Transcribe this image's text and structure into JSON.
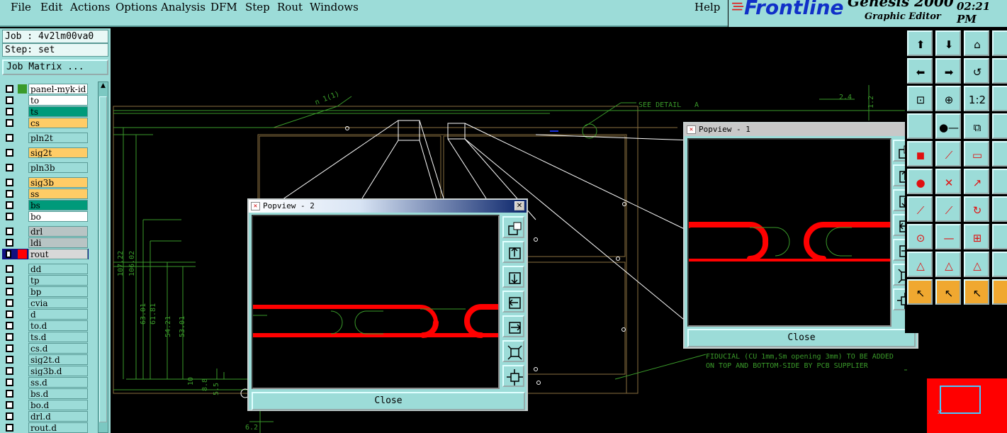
{
  "menu": {
    "items": [
      "File",
      "Edit",
      "Actions",
      "Options",
      "Analysis",
      "DFM",
      "Step",
      "Rout",
      "Windows"
    ],
    "help": "Help"
  },
  "brand": {
    "logo": "Frontline",
    "app": "Genesis 2000",
    "subtitle": "Graphic Editor",
    "clock": "02:21 PM"
  },
  "job": {
    "job_line": "Job : 4v2lm00va0",
    "step_line": "Step: set",
    "matrix_button": "Job Matrix ..."
  },
  "layers": [
    {
      "name": "panel-myk-id",
      "color": "#ffffff",
      "swatch": "#3a9a2a",
      "checked": false
    },
    {
      "name": "to",
      "color": "#ffffff",
      "swatch": "",
      "checked": false
    },
    {
      "name": "ts",
      "color": "#009a7a",
      "swatch": "",
      "checked": false
    },
    {
      "name": "cs",
      "color": "#ffcc66",
      "swatch": "",
      "checked": false
    },
    {
      "name": "pln2t",
      "color": "#9cdcd8",
      "swatch": "",
      "checked": false
    },
    {
      "name": "sig2t",
      "color": "#ffcc66",
      "swatch": "",
      "checked": false
    },
    {
      "name": "pln3b",
      "color": "#9cdcd8",
      "swatch": "",
      "checked": false
    },
    {
      "name": "sig3b",
      "color": "#ffcc66",
      "swatch": "",
      "checked": false
    },
    {
      "name": "ss",
      "color": "#ffcc66",
      "swatch": "",
      "checked": false
    },
    {
      "name": "bs",
      "color": "#009a7a",
      "swatch": "",
      "checked": false
    },
    {
      "name": "bo",
      "color": "#ffffff",
      "swatch": "",
      "checked": false
    },
    {
      "name": "drl",
      "color": "#b8c4c4",
      "swatch": "",
      "checked": false
    },
    {
      "name": "ldi",
      "color": "#b8c4c4",
      "swatch": "",
      "checked": false
    },
    {
      "name": "rout",
      "color": "#d8d8d8",
      "swatch": "#ff0000",
      "checked": true
    },
    {
      "name": "dd",
      "color": "#9cdcd8",
      "swatch": "",
      "checked": false
    },
    {
      "name": "tp",
      "color": "#9cdcd8",
      "swatch": "",
      "checked": false
    },
    {
      "name": "bp",
      "color": "#9cdcd8",
      "swatch": "",
      "checked": false
    },
    {
      "name": "cvia",
      "color": "#9cdcd8",
      "swatch": "",
      "checked": false
    },
    {
      "name": "d",
      "color": "#9cdcd8",
      "swatch": "",
      "checked": false
    },
    {
      "name": "to.d",
      "color": "#9cdcd8",
      "swatch": "",
      "checked": false
    },
    {
      "name": "ts.d",
      "color": "#9cdcd8",
      "swatch": "",
      "checked": false
    },
    {
      "name": "cs.d",
      "color": "#9cdcd8",
      "swatch": "",
      "checked": false
    },
    {
      "name": "sig2t.d",
      "color": "#9cdcd8",
      "swatch": "",
      "checked": false
    },
    {
      "name": "sig3b.d",
      "color": "#9cdcd8",
      "swatch": "",
      "checked": false
    },
    {
      "name": "ss.d",
      "color": "#9cdcd8",
      "swatch": "",
      "checked": false
    },
    {
      "name": "bs.d",
      "color": "#9cdcd8",
      "swatch": "",
      "checked": false
    },
    {
      "name": "bo.d",
      "color": "#9cdcd8",
      "swatch": "",
      "checked": false
    },
    {
      "name": "drl.d",
      "color": "#9cdcd8",
      "swatch": "",
      "checked": false
    },
    {
      "name": "rout.d",
      "color": "#9cdcd8",
      "swatch": "",
      "checked": false
    }
  ],
  "canvas": {
    "detail_label": "SEE DETAIL",
    "detail_letter": "A",
    "dim_top": "2.4",
    "dim_right": "1.2",
    "dims_vertical": [
      "107.22",
      "106.02",
      "63.01",
      "61.81",
      "54.21",
      "53.01",
      "10",
      "8.8",
      "5.5"
    ],
    "dim_bottom": "6.2",
    "leader_label": "n 1(1)",
    "fiducial_line1": "FIDUCIAL (CU 1mm,Sm opening 3mm) TO BE ADDED",
    "fiducial_line2": "ON TOP AND BOTTOM-SIDE BY PCB SUPPLIER"
  },
  "popup2": {
    "title": "Popview - 2",
    "close": "Close"
  },
  "popup1": {
    "title": "Popview - 1",
    "close": "Close"
  },
  "colors": {
    "ui_bg": "#9cdcd8",
    "rout": "#ff0000",
    "drawing": "#3a9a2a",
    "outline": "#8a7040"
  }
}
